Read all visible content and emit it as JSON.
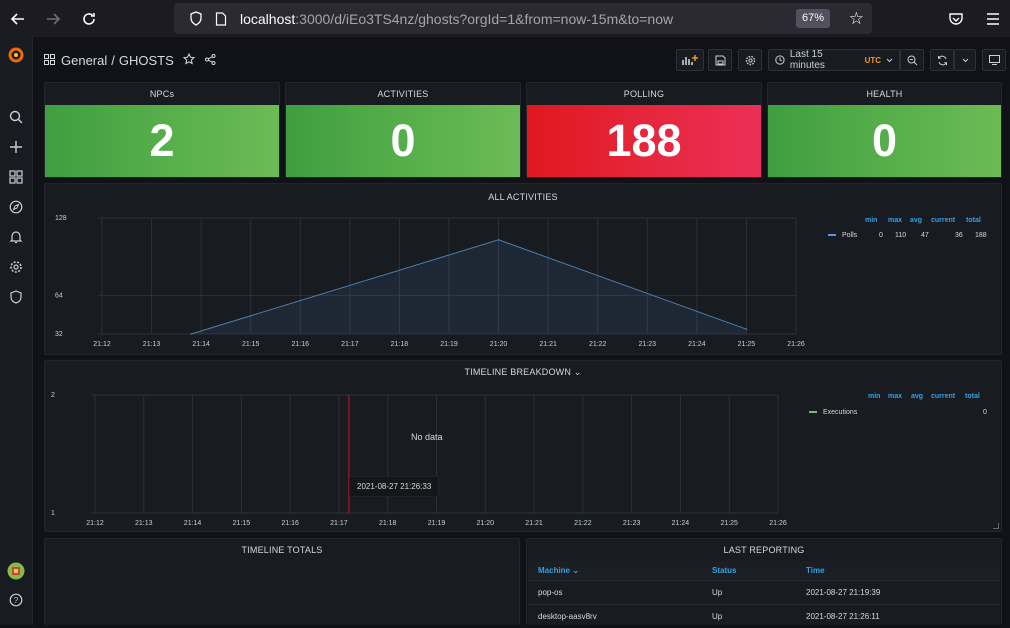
{
  "browser": {
    "url_host": "localhost",
    "url_rest": ":3000/d/iEo3TS4nz/ghosts?orgId=1&from=now-15m&to=now",
    "zoom": "67%"
  },
  "dashboard": {
    "folder": "General",
    "separator": "/",
    "title": "GHOSTS",
    "time_range": "Last 15 minutes",
    "timezone": "UTC"
  },
  "stats": [
    {
      "title": "NPCs",
      "value": "2",
      "color": "#56ae4a"
    },
    {
      "title": "ACTIVITIES",
      "value": "0",
      "color": "#56ae4a"
    },
    {
      "title": "POLLING",
      "value": "188",
      "color": "#e5263b"
    },
    {
      "title": "HEALTH",
      "value": "0",
      "color": "#56ae4a"
    }
  ],
  "all_activities": {
    "title": "ALL ACTIVITIES",
    "legend_headers": [
      "min",
      "max",
      "avg",
      "current",
      "total"
    ],
    "legend": {
      "name": "Polls",
      "min": "0",
      "max": "110",
      "avg": "47",
      "current": "36",
      "total": "188",
      "color": "#5794f2"
    }
  },
  "timeline_breakdown": {
    "title": "TIMELINE BREAKDOWN",
    "no_data": "No data",
    "tooltip": "2021-08-27 21:26:33",
    "legend_headers": [
      "min",
      "max",
      "avg",
      "current",
      "total"
    ],
    "legend": {
      "name": "Executions",
      "total": "0",
      "color": "#73bf69"
    }
  },
  "timeline_totals": {
    "title": "TIMELINE TOTALS"
  },
  "last_reporting": {
    "title": "LAST REPORTING",
    "columns": [
      "Machine",
      "Status",
      "Time"
    ],
    "rows": [
      {
        "machine": "pop-os",
        "status": "Up",
        "time": "2021-08-27 21:19:39"
      },
      {
        "machine": "desktop-aasv8rv",
        "status": "Up",
        "time": "2021-08-27 21:26:11"
      }
    ]
  },
  "chart_data": [
    {
      "type": "area",
      "title": "ALL ACTIVITIES",
      "x": [
        "21:12",
        "21:13",
        "21:14",
        "21:15",
        "21:16",
        "21:17",
        "21:18",
        "21:19",
        "21:20",
        "21:21",
        "21:22",
        "21:23",
        "21:24",
        "21:25",
        "21:26"
      ],
      "yticks": [
        "32",
        "64",
        "128"
      ],
      "ylim": [
        32,
        128
      ],
      "series": [
        {
          "name": "Polls",
          "points": [
            [
              "21:13.8",
              32
            ],
            [
              "21:20",
              110
            ],
            [
              "21:25",
              36
            ]
          ]
        }
      ]
    },
    {
      "type": "line",
      "title": "TIMELINE BREAKDOWN",
      "x": [
        "21:12",
        "21:13",
        "21:14",
        "21:15",
        "21:16",
        "21:17",
        "21:18",
        "21:19",
        "21:20",
        "21:21",
        "21:22",
        "21:23",
        "21:24",
        "21:25",
        "21:26"
      ],
      "yticks": [
        "1",
        "2"
      ],
      "ylim": [
        1,
        2
      ],
      "series": [
        {
          "name": "Executions",
          "values": []
        }
      ]
    }
  ]
}
